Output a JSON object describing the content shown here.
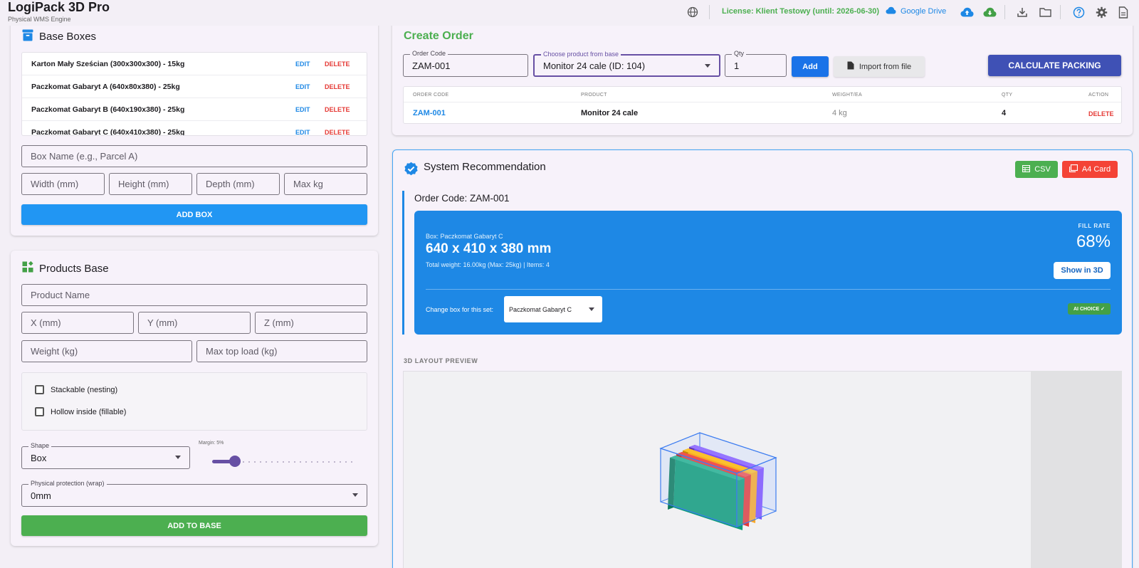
{
  "app": {
    "title": "LogiPack 3D Pro",
    "subtitle": "Physical WMS Engine",
    "license": "License: Klient Testowy (until: 2026-06-30)",
    "google_drive": "Google Drive",
    "icons": [
      "globe-icon",
      "cloud-upload-icon",
      "cloud-download-icon",
      "download-icon",
      "folder-icon",
      "help-icon",
      "settings-icon",
      "document-icon"
    ]
  },
  "base_boxes": {
    "title": "Base Boxes",
    "items": [
      {
        "name": "Karton Mały Sześcian (300x300x300) - 15kg",
        "edit": "EDIT",
        "delete": "DELETE"
      },
      {
        "name": "Paczkomat Gabaryt A (640x80x380) - 25kg",
        "edit": "EDIT",
        "delete": "DELETE"
      },
      {
        "name": "Paczkomat Gabaryt B (640x190x380) - 25kg",
        "edit": "EDIT",
        "delete": "DELETE"
      },
      {
        "name": "Paczkomat Gabaryt C (640x410x380) - 25kg",
        "edit": "EDIT",
        "delete": "DELETE"
      }
    ],
    "form": {
      "box_name_placeholder": "Box Name (e.g., Parcel A)",
      "width_placeholder": "Width (mm)",
      "height_placeholder": "Height (mm)",
      "depth_placeholder": "Depth (mm)",
      "maxkg_placeholder": "Max kg",
      "add_button": "ADD BOX"
    }
  },
  "products_base": {
    "title": "Products Base",
    "product_name_placeholder": "Product Name",
    "x_placeholder": "X (mm)",
    "y_placeholder": "Y (mm)",
    "z_placeholder": "Z (mm)",
    "weight_placeholder": "Weight (kg)",
    "max_top_load_placeholder": "Max top load (kg)",
    "stackable_label": "Stackable (nesting)",
    "hollow_label": "Hollow inside (fillable)",
    "shape_label": "Shape",
    "shape_value": "Box",
    "margin_label": "Margin: 5%",
    "margin_value": 0.16,
    "protection_label": "Physical protection (wrap)",
    "protection_value": "0mm",
    "add_button": "ADD TO BASE"
  },
  "create_order": {
    "title": "Create Order",
    "order_code_label": "Order Code",
    "order_code_value": "ZAM-001",
    "product_label": "Choose product from base",
    "product_value": "Monitor 24 cale (ID: 104)",
    "qty_label": "Qty",
    "qty_value": "1",
    "add_button": "Add",
    "import_button": "Import from file",
    "calculate_button": "CALCULATE PACKING",
    "table": {
      "headers": [
        "ORDER CODE",
        "PRODUCT",
        "WEIGHT/EA",
        "QTY",
        "ACTION"
      ],
      "rows": [
        {
          "code": "ZAM-001",
          "product": "Monitor 24 cale",
          "weight": "4 kg",
          "qty": "4",
          "action": "DELETE"
        }
      ]
    }
  },
  "recommendation": {
    "title": "System Recommendation",
    "csv_button": "CSV",
    "a4_button": "A4 Card",
    "order_code_line": "Order Code: ZAM-001",
    "box_name": "Box: Paczkomat Gabaryt C",
    "dims": "640 x 410 x 380 mm",
    "weight_line": "Total weight: 16.00kg (Max: 25kg) | Items: 4",
    "fill_rate_label": "FILL RATE",
    "fill_rate_value": "68%",
    "show_3d_button": "Show in 3D",
    "change_box_label": "Change box for this set:",
    "change_box_value": "Paczkomat Gabaryt C",
    "ai_badge": "AI CHOICE ✓",
    "preview_label": "3D LAYOUT PREVIEW"
  },
  "colors": {
    "accent_blue": "#1e88e5",
    "accent_green": "#4caf50",
    "accent_red": "#f44336",
    "indigo": "#3f51b5",
    "purple": "#6750a4",
    "item_colors": [
      "#7c4dff",
      "#f9a825",
      "#e53935",
      "#0f9d78"
    ]
  }
}
